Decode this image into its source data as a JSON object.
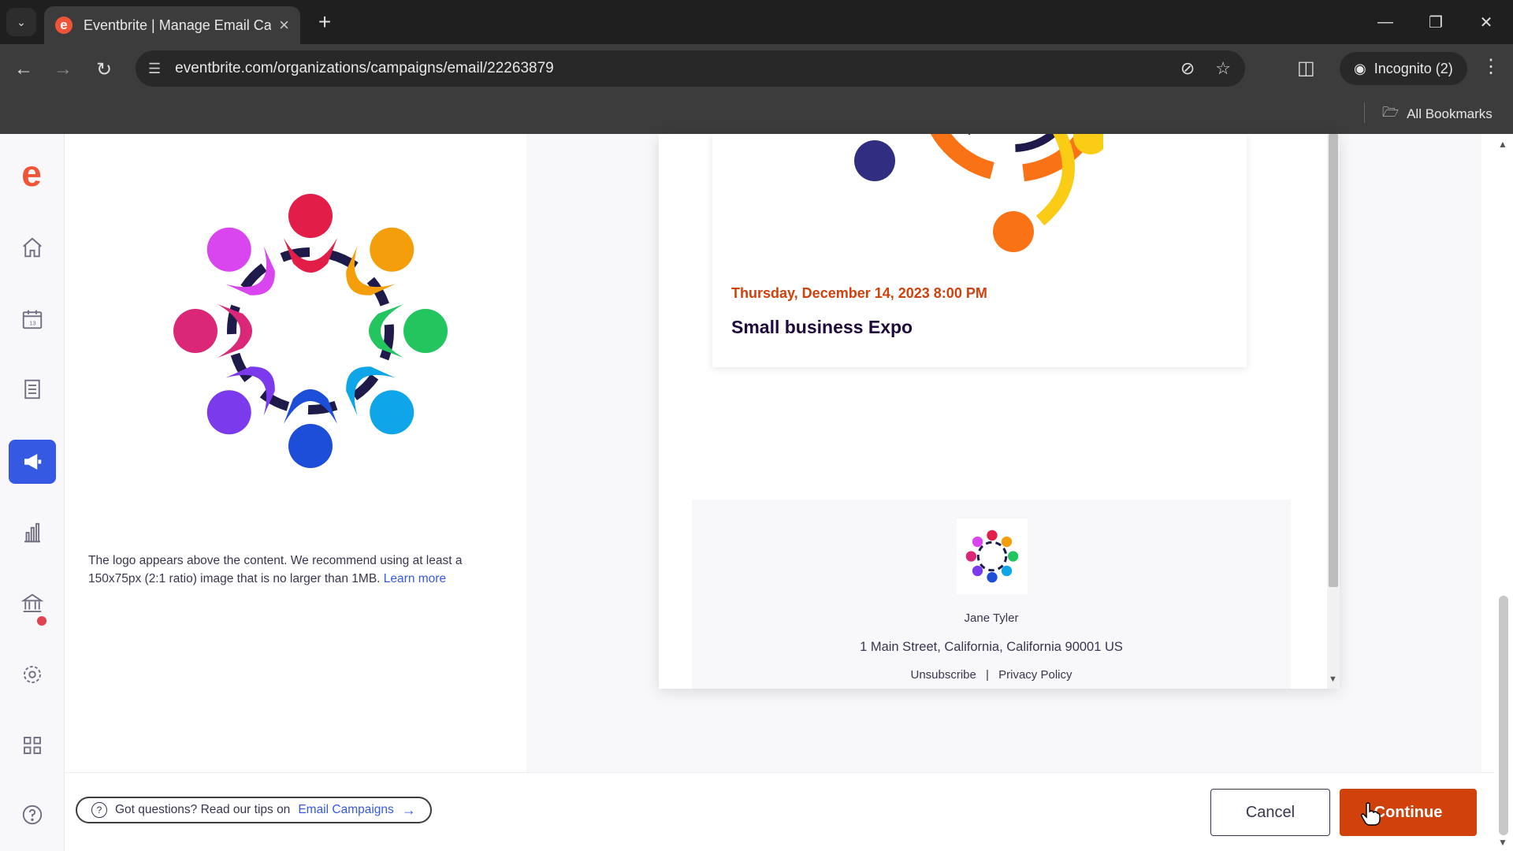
{
  "browser": {
    "tab_title": "Eventbrite | Manage Email Campaigns",
    "tab_favicon": "e",
    "url": "eventbrite.com/organizations/campaigns/email/22263879",
    "incognito_label": "Incognito (2)",
    "bookmarks_label": "All Bookmarks"
  },
  "sidenav": {
    "logo": "e",
    "items": [
      {
        "name": "home-icon",
        "active": false
      },
      {
        "name": "calendar-icon",
        "active": false
      },
      {
        "name": "orders-icon",
        "active": false
      },
      {
        "name": "marketing-icon",
        "active": true
      },
      {
        "name": "reports-icon",
        "active": false
      },
      {
        "name": "finance-icon",
        "active": false
      },
      {
        "name": "settings-icon",
        "active": false
      },
      {
        "name": "apps-icon",
        "active": false
      },
      {
        "name": "help-icon",
        "active": false
      }
    ]
  },
  "editor": {
    "logo_caption": "The logo appears above the content. We recommend using at least a 150x75px (2:1 ratio) image that is no larger than 1MB.",
    "learn_more": "Learn more"
  },
  "email_preview": {
    "event_date": "Thursday, December 14, 2023 8:00 PM",
    "event_title": "Small business Expo",
    "organizer_name": "Jane Tyler",
    "address": "1 Main Street, California, California 90001 US",
    "unsubscribe": "Unsubscribe",
    "separator": "|",
    "privacy": "Privacy Policy"
  },
  "footer": {
    "tips_prefix": "Got questions? Read our tips on",
    "tips_link": "Email Campaigns",
    "cancel": "Cancel",
    "continue": "Continue"
  },
  "colors": {
    "brand_orange": "#f05537",
    "primary_blue": "#3659e3",
    "continue_bg": "#d1410c"
  }
}
